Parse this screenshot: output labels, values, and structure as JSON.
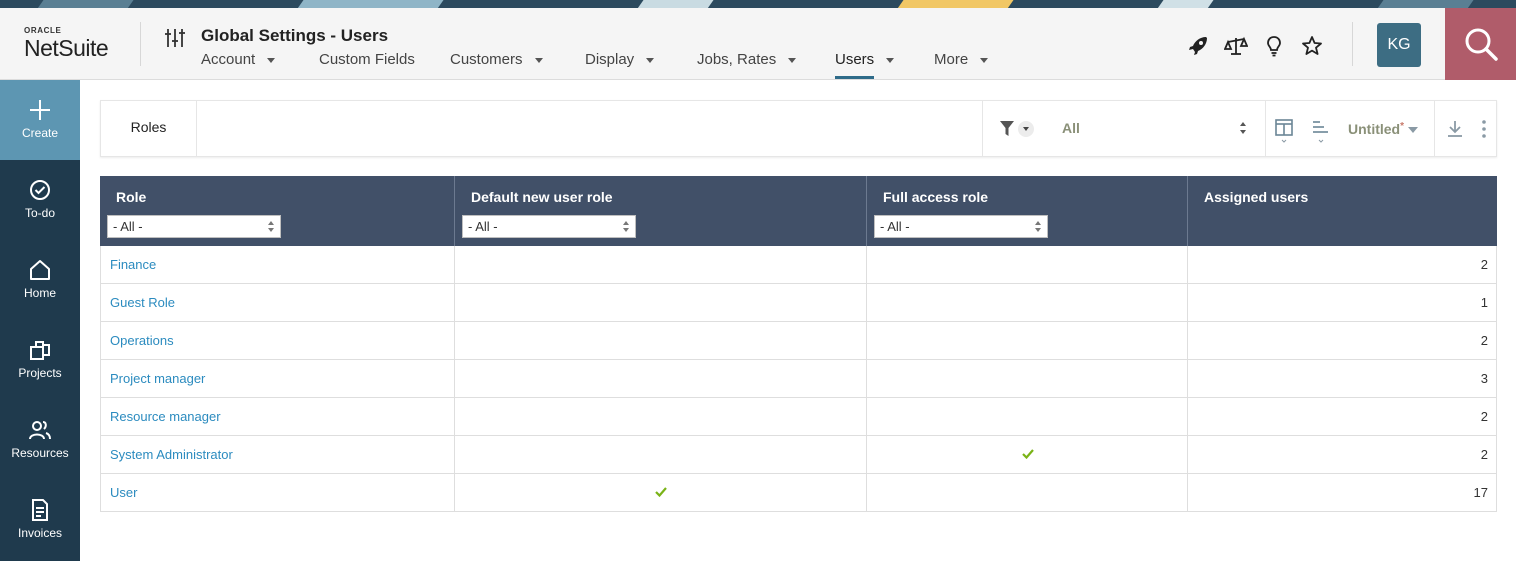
{
  "header": {
    "logo_small": "ORACLE",
    "logo_main": "NetSuite",
    "page_title": "Global Settings - Users",
    "nav": [
      {
        "label": "Account",
        "has_caret": true,
        "active": false
      },
      {
        "label": "Custom Fields",
        "has_caret": false,
        "active": false
      },
      {
        "label": "Customers",
        "has_caret": true,
        "active": false
      },
      {
        "label": "Display",
        "has_caret": true,
        "active": false
      },
      {
        "label": "Jobs, Rates",
        "has_caret": true,
        "active": false
      },
      {
        "label": "Users",
        "has_caret": true,
        "active": true
      },
      {
        "label": "More",
        "has_caret": true,
        "active": false
      }
    ],
    "icons": [
      "rocket-icon",
      "scale-icon",
      "lightbulb-icon",
      "star-icon"
    ],
    "avatar_initials": "KG",
    "search_icon": "search-icon",
    "colors": {
      "accent": "#2e6b89",
      "search_bg": "#b05c6a",
      "avatar_bg": "#3d6d83"
    }
  },
  "sidebar": {
    "items": [
      {
        "label": "Create",
        "icon": "plus-icon"
      },
      {
        "label": "To-do",
        "icon": "check-circle-icon"
      },
      {
        "label": "Home",
        "icon": "home-icon"
      },
      {
        "label": "Projects",
        "icon": "projects-icon"
      },
      {
        "label": "Resources",
        "icon": "people-icon"
      },
      {
        "label": "Invoices",
        "icon": "invoice-icon"
      }
    ],
    "colors": {
      "bg": "#1f3a4d",
      "active_bg": "#5d96b2"
    }
  },
  "toolbar": {
    "title": "Roles",
    "filter_value": "All",
    "view_name": "Untitled",
    "view_modified_marker": "*"
  },
  "table": {
    "columns": [
      {
        "label": "Role",
        "filter": "- All -"
      },
      {
        "label": "Default new user role",
        "filter": "- All -"
      },
      {
        "label": "Full access role",
        "filter": "- All -"
      },
      {
        "label": "Assigned users",
        "filter": null
      }
    ],
    "rows": [
      {
        "role": "Finance",
        "default_new_user": false,
        "full_access": false,
        "assigned_users": "2"
      },
      {
        "role": "Guest Role",
        "default_new_user": false,
        "full_access": false,
        "assigned_users": "1"
      },
      {
        "role": "Operations",
        "default_new_user": false,
        "full_access": false,
        "assigned_users": "2"
      },
      {
        "role": "Project manager",
        "default_new_user": false,
        "full_access": false,
        "assigned_users": "3"
      },
      {
        "role": "Resource manager",
        "default_new_user": false,
        "full_access": false,
        "assigned_users": "2"
      },
      {
        "role": "System Administrator",
        "default_new_user": false,
        "full_access": true,
        "assigned_users": "2"
      },
      {
        "role": "User",
        "default_new_user": true,
        "full_access": false,
        "assigned_users": "17"
      }
    ],
    "colors": {
      "header_bg": "#415068",
      "link": "#2b8bbf",
      "check": "#7ab317"
    }
  }
}
